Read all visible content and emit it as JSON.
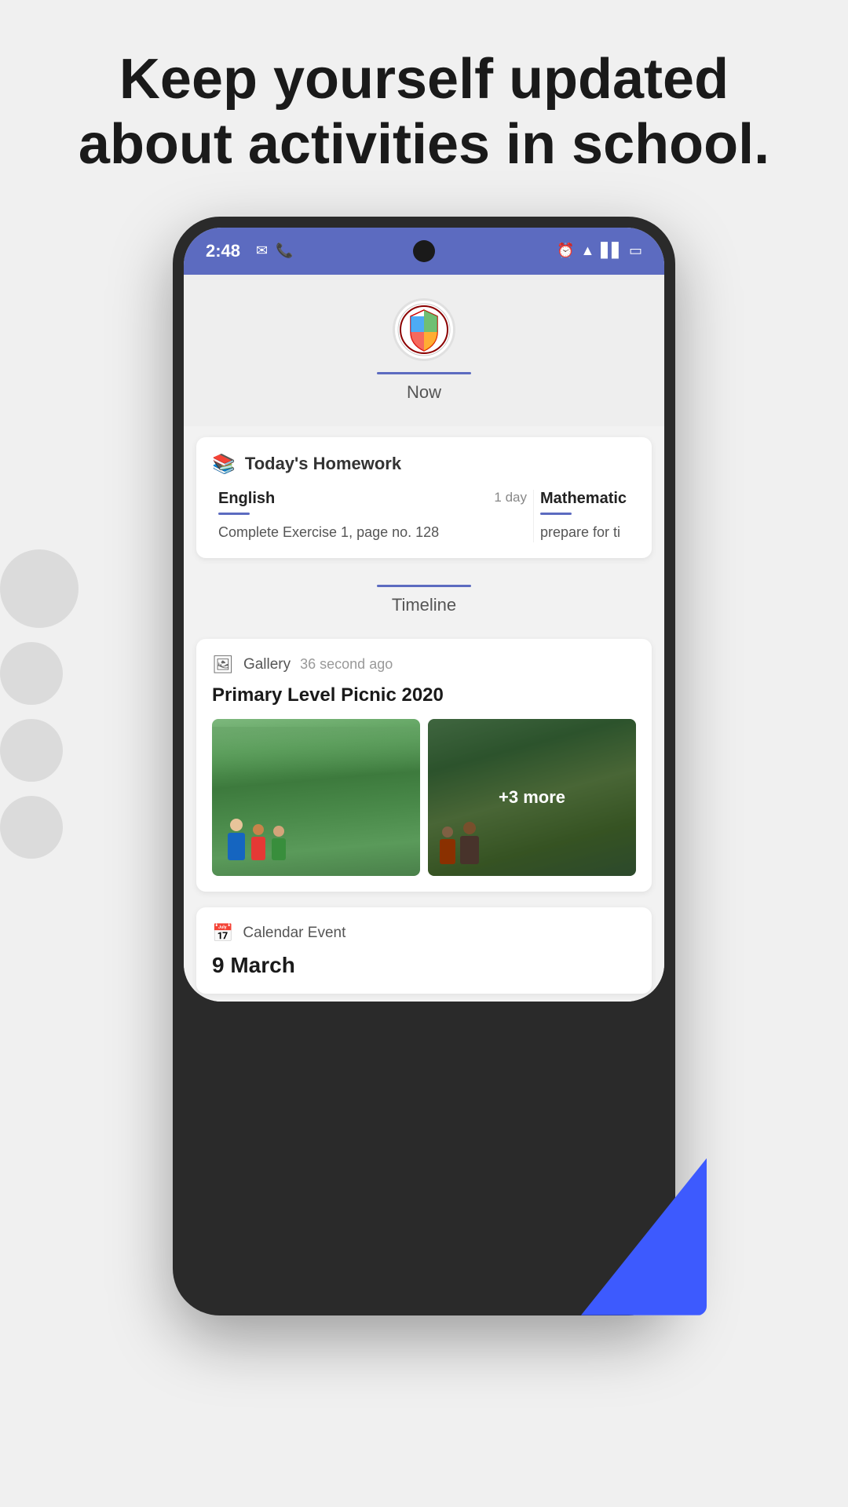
{
  "header": {
    "title_line1": "Keep yourself updated",
    "title_line2": "about activities in school."
  },
  "status_bar": {
    "time": "2:48",
    "left_icons": [
      "message-icon",
      "phone-icon"
    ],
    "right_icons": [
      "alarm-icon",
      "wifi-icon",
      "signal-icon",
      "battery-icon"
    ]
  },
  "school_section": {
    "now_label": "Now"
  },
  "homework_card": {
    "title": "Today's Homework",
    "subjects": [
      {
        "name": "English",
        "due": "1 day",
        "task": "Complete Exercise 1, page no. 128"
      },
      {
        "name": "Mathematic",
        "due": "",
        "task": "prepare for ti"
      }
    ]
  },
  "timeline_section": {
    "label": "Timeline"
  },
  "gallery_card": {
    "meta_label": "Gallery",
    "meta_time": "36 second ago",
    "title": "Primary Level Picnic 2020",
    "more_count": "+3 more"
  },
  "calendar_card": {
    "meta_label": "Calendar Event",
    "date": "9 March"
  }
}
